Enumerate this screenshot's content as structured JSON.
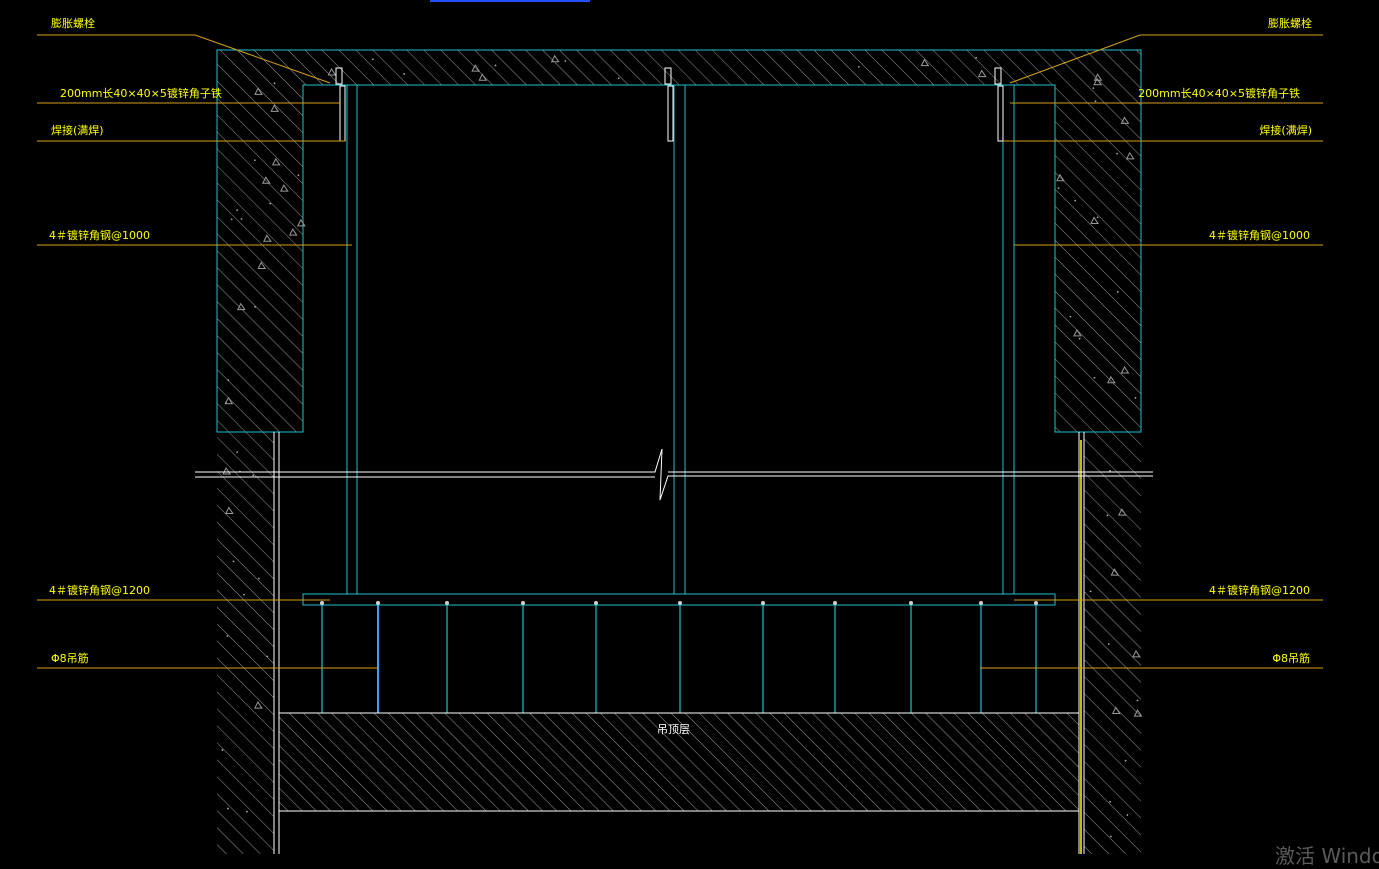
{
  "labels": {
    "expansion_bolt": "膨胀螺栓",
    "angle_code": "200mm长40×40×5镀锌角子铁",
    "weld": "焊接(满焊)",
    "angle_1000": "4＃镀锌角钢@1000",
    "angle_1200": "4＃镀锌角钢@1200",
    "hanger_bar": "Φ8吊筋",
    "ceiling_layer": "吊顶层"
  },
  "watermark": "激活 Windo",
  "colors": {
    "background": "#000000",
    "structure_line": "#ffffff",
    "member_line": "#20c0d0",
    "leader_line": "#d4a017",
    "label_text": "#ffff00",
    "hanger": "#3aa0ff",
    "hatch": "#b0b0b0"
  }
}
